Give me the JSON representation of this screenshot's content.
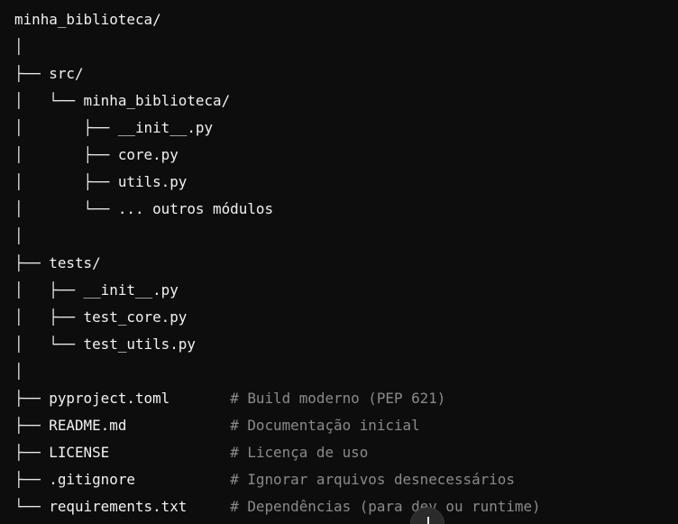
{
  "code_block": {
    "lines": [
      {
        "tree": "",
        "name": "minha_biblioteca/",
        "comment": ""
      },
      {
        "tree": "│",
        "name": "",
        "comment": ""
      },
      {
        "tree": "├── ",
        "name": "src/",
        "comment": ""
      },
      {
        "tree": "│   └── ",
        "name": "minha_biblioteca/",
        "comment": ""
      },
      {
        "tree": "│       ├── ",
        "name": "__init__.py",
        "comment": ""
      },
      {
        "tree": "│       ├── ",
        "name": "core.py",
        "comment": ""
      },
      {
        "tree": "│       ├── ",
        "name": "utils.py",
        "comment": ""
      },
      {
        "tree": "│       └── ",
        "name": "... outros módulos",
        "comment": ""
      },
      {
        "tree": "│",
        "name": "",
        "comment": ""
      },
      {
        "tree": "├── ",
        "name": "tests/",
        "comment": ""
      },
      {
        "tree": "│   ├── ",
        "name": "__init__.py",
        "comment": ""
      },
      {
        "tree": "│   ├── ",
        "name": "test_core.py",
        "comment": ""
      },
      {
        "tree": "│   └── ",
        "name": "test_utils.py",
        "comment": ""
      },
      {
        "tree": "│",
        "name": "",
        "comment": ""
      },
      {
        "tree": "├── ",
        "name": "pyproject.toml       ",
        "comment": "# Build moderno (PEP 621)"
      },
      {
        "tree": "├── ",
        "name": "README.md            ",
        "comment": "# Documentação inicial"
      },
      {
        "tree": "├── ",
        "name": "LICENSE              ",
        "comment": "# Licença de uso"
      },
      {
        "tree": "├── ",
        "name": ".gitignore           ",
        "comment": "# Ignorar arquivos desnecessários"
      },
      {
        "tree": "└── ",
        "name": "requirements.txt     ",
        "comment": "# Dependências (para dev ou runtime)"
      }
    ]
  },
  "scroll_button": {
    "icon": "arrow-down-icon"
  }
}
